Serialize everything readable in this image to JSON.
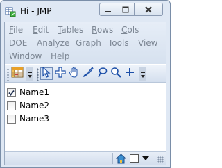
{
  "window": {
    "title": "Hi - JMP",
    "controls": [
      "minimize-icon",
      "maximize-icon",
      "close-icon"
    ]
  },
  "menu": {
    "row1": [
      {
        "label": "File",
        "accel": "F",
        "rest": "ile"
      },
      {
        "label": "Edit",
        "accel": "E",
        "rest": "dit"
      },
      {
        "label": "Tables",
        "accel": "T",
        "rest": "ables"
      },
      {
        "label": "Rows",
        "accel": "R",
        "rest": "ows"
      },
      {
        "label": "Cols",
        "accel": "C",
        "rest": "ols"
      }
    ],
    "row2": [
      {
        "label": "DOE",
        "accel": "D",
        "rest": "OE"
      },
      {
        "label": "Analyze",
        "accel": "A",
        "rest": "nalyze"
      },
      {
        "label": "Graph",
        "accel": "G",
        "rest": "raph"
      },
      {
        "label": "Tools",
        "accel": "T",
        "rest": "ools"
      },
      {
        "label": "View",
        "accel": "V",
        "rest": "iew"
      }
    ],
    "row3": [
      {
        "label": "Window",
        "accel": "W",
        "rest": "indow"
      },
      {
        "label": "Help",
        "accel": "H",
        "rest": "elp"
      }
    ],
    "state": "disabled"
  },
  "toolbar": {
    "tools": [
      "table-grid-icon",
      "arrow-pointer-icon",
      "crosshair-icon",
      "grabber-hand-icon",
      "brush-icon",
      "lasso-icon",
      "magnifier-icon",
      "plus-icon"
    ],
    "selected_tool": "arrow-pointer-icon"
  },
  "columns": [
    {
      "name": "Name1",
      "checked": true
    },
    {
      "name": "Name2",
      "checked": false
    },
    {
      "name": "Name3",
      "checked": false
    }
  ],
  "statusbar": {
    "icons": [
      "home-icon",
      "checkbox-icon",
      "dropdown-arrow-icon"
    ]
  },
  "colors": {
    "frame": "#dfe8f4",
    "menu_disabled_text": "#7d8794",
    "toolbar_icon_blue": "#1c4fa8",
    "table_icon_orange": "#e8a028"
  }
}
